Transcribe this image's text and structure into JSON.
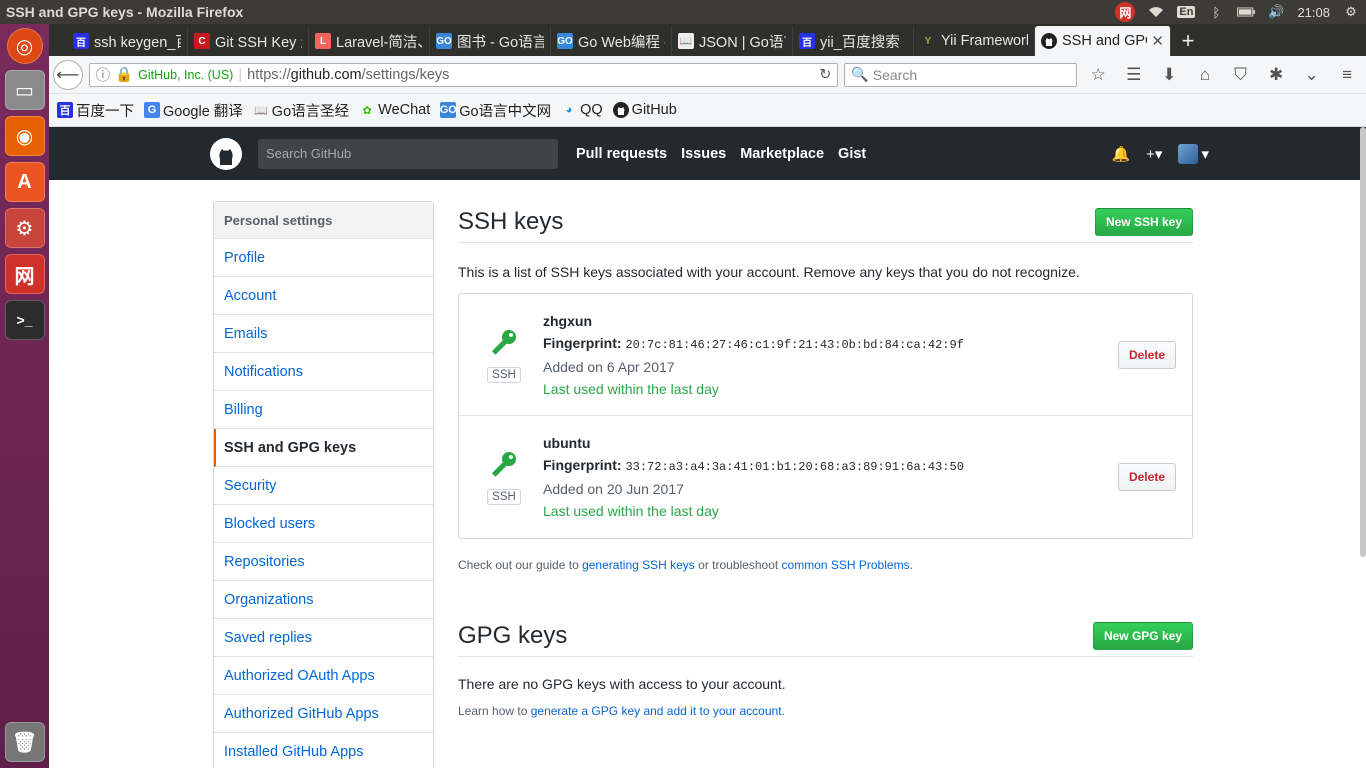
{
  "os": {
    "window_title": "SSH and GPG keys - Mozilla Firefox",
    "clock": "21:08",
    "keyboard_layout": "En"
  },
  "tabs": [
    {
      "title": "ssh keygen_百",
      "favicon": "baidu-icon"
    },
    {
      "title": "Git SSH Key 生",
      "favicon": "csdn-icon"
    },
    {
      "title": "Laravel-简洁、",
      "favicon": "laravel-icon"
    },
    {
      "title": "图书 - Go语言中",
      "favicon": "go-icon"
    },
    {
      "title": "Go Web编程 - (",
      "favicon": "go-icon"
    },
    {
      "title": "JSON | Go语言",
      "favicon": "book-icon"
    },
    {
      "title": "yii_百度搜索",
      "favicon": "baidu-icon"
    },
    {
      "title": "Yii Framework",
      "favicon": "yii-icon"
    },
    {
      "title": "SSH and GPG",
      "favicon": "github-icon",
      "active": true
    }
  ],
  "navbar": {
    "site_identity": "GitHub, Inc. (US)",
    "url_prefix": "https://",
    "url_host": "github.com",
    "url_path": "/settings/keys",
    "search_placeholder": "Search"
  },
  "bookmarks": [
    {
      "label": "百度一下",
      "icon": "baidu-icon"
    },
    {
      "label": "Google 翻译",
      "icon": "google-translate-icon"
    },
    {
      "label": "Go语言圣经",
      "icon": "book-icon"
    },
    {
      "label": "WeChat",
      "icon": "wechat-icon"
    },
    {
      "label": "Go语言中文网",
      "icon": "go-icon"
    },
    {
      "label": "QQ",
      "icon": "qq-icon"
    },
    {
      "label": "GitHub",
      "icon": "github-icon"
    }
  ],
  "gh_header": {
    "search_placeholder": "Search GitHub",
    "nav": [
      "Pull requests",
      "Issues",
      "Marketplace",
      "Gist"
    ]
  },
  "sidebar": {
    "heading": "Personal settings",
    "items": [
      {
        "label": "Profile"
      },
      {
        "label": "Account"
      },
      {
        "label": "Emails"
      },
      {
        "label": "Notifications"
      },
      {
        "label": "Billing"
      },
      {
        "label": "SSH and GPG keys",
        "selected": true
      },
      {
        "label": "Security"
      },
      {
        "label": "Blocked users"
      },
      {
        "label": "Repositories"
      },
      {
        "label": "Organizations"
      },
      {
        "label": "Saved replies"
      },
      {
        "label": "Authorized OAuth Apps"
      },
      {
        "label": "Authorized GitHub Apps"
      },
      {
        "label": "Installed GitHub Apps"
      }
    ]
  },
  "ssh": {
    "title": "SSH keys",
    "new_button": "New SSH key",
    "description": "This is a list of SSH keys associated with your account. Remove any keys that you do not recognize.",
    "badge": "SSH",
    "fingerprint_label": "Fingerprint:",
    "delete_label": "Delete",
    "keys": [
      {
        "name": "zhgxun",
        "fingerprint": "20:7c:81:46:27:46:c1:9f:21:43:0b:bd:84:ca:42:9f",
        "added": "Added on 6 Apr 2017",
        "last_used": "Last used within the last day"
      },
      {
        "name": "ubuntu",
        "fingerprint": "33:72:a3:a4:3a:41:01:b1:20:68:a3:89:91:6a:43:50",
        "added": "Added on 20 Jun 2017",
        "last_used": "Last used within the last day"
      }
    ],
    "guide_prefix": "Check out our guide to ",
    "guide_link": "generating SSH keys",
    "guide_middle": " or troubleshoot ",
    "guide_link2": "common SSH Problems",
    "guide_suffix": "."
  },
  "gpg": {
    "title": "GPG keys",
    "new_button": "New GPG key",
    "empty": "There are no GPG keys with access to your account.",
    "learn_prefix": "Learn how to ",
    "learn_link": "generate a GPG key and add it to your account",
    "learn_suffix": "."
  },
  "colors": {
    "accent_green": "#28a745",
    "link_blue": "#0366d6",
    "danger_red": "#cb2431",
    "selected_border": "#e36209",
    "gh_header": "#24292e"
  }
}
